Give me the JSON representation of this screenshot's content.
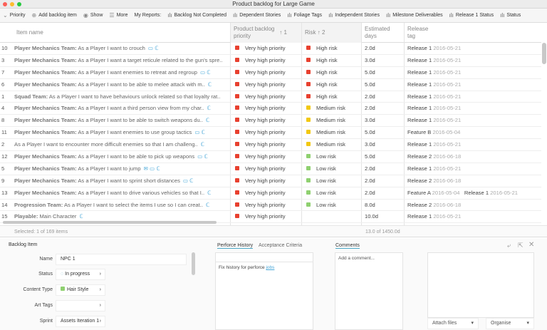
{
  "window": {
    "title": "Product backlog for Large Game"
  },
  "toolbar": {
    "items": [
      {
        "icon": "chevron-down-icon",
        "glyph": "⌄",
        "label": "Priority"
      },
      {
        "icon": "plus-circle-icon",
        "glyph": "⊕",
        "label": "Add backlog item"
      },
      {
        "icon": "eye-icon",
        "glyph": "◉",
        "label": "Show"
      },
      {
        "icon": "menu-icon",
        "glyph": "☰",
        "label": "More"
      },
      {
        "icon": "",
        "glyph": "",
        "label": "My Reports:"
      },
      {
        "icon": "bar-chart-icon",
        "glyph": "ılı",
        "label": "Backlog Not Completed"
      },
      {
        "icon": "bar-chart-icon",
        "glyph": "ılı",
        "label": "Dependent Stories"
      },
      {
        "icon": "bar-chart-icon",
        "glyph": "ılı",
        "label": "Foliage Tags"
      },
      {
        "icon": "bar-chart-icon",
        "glyph": "ılı",
        "label": "Independent Stories"
      },
      {
        "icon": "bar-chart-icon",
        "glyph": "ılı",
        "label": "Milestone Deliverables"
      },
      {
        "icon": "bar-chart-icon",
        "glyph": "ılı",
        "label": "Release 1 Status"
      },
      {
        "icon": "bar-chart-icon",
        "glyph": "ılı",
        "label": "Status"
      }
    ]
  },
  "table": {
    "headers": {
      "name": "Item name",
      "priority": "Product backlog priority",
      "priority_sort": "↑ 1",
      "risk": "Risk",
      "risk_sort": "↑ 2",
      "days": "Estimated days",
      "release": "Release tag"
    },
    "colors": {
      "Very high priority": "#e8402f",
      "High risk": "#e8402f",
      "Medium risk": "#f2c811",
      "Low risk": "#8fd070"
    },
    "rows": [
      {
        "id": "10",
        "team": "Player Mechanics Team:",
        "text": "As a Player I want to crouch",
        "icons": "▭ ℂ",
        "priority": "Very high priority",
        "risk": "High risk",
        "days": "2.0d",
        "tags": [
          [
            "Release 1",
            "2016-05-21"
          ]
        ]
      },
      {
        "id": "3",
        "team": "Player Mechanics Team:",
        "text": "As a Player I want a target reticule related to the gun's spre..",
        "icons": "",
        "priority": "Very high priority",
        "risk": "High risk",
        "days": "3.0d",
        "tags": [
          [
            "Release 1",
            "2016-05-21"
          ]
        ]
      },
      {
        "id": "7",
        "team": "Player Mechanics Team:",
        "text": "As a Player I want enemies to retreat and regroup",
        "icons": "▭ ℂ",
        "priority": "Very high priority",
        "risk": "High risk",
        "days": "5.0d",
        "tags": [
          [
            "Release 1",
            "2016-05-21"
          ]
        ]
      },
      {
        "id": "6",
        "team": "Player Mechanics Team:",
        "text": "As a Player I want to be able to melee attack with m..",
        "icons": "ℂ",
        "priority": "Very high priority",
        "risk": "High risk",
        "days": "5.0d",
        "tags": [
          [
            "Release 1",
            "2016-05-21"
          ]
        ]
      },
      {
        "id": "1",
        "team": "Squad Team:",
        "text": "As a Player I want to have behaviours unlock related so that loyalty rat..",
        "icons": "",
        "priority": "Very high priority",
        "risk": "High risk",
        "days": "2.0d",
        "tags": [
          [
            "Release 1",
            "2016-05-21"
          ]
        ]
      },
      {
        "id": "4",
        "team": "Player Mechanics Team:",
        "text": "As a Player I want a third person view from my char..",
        "icons": "ℂ",
        "priority": "Very high priority",
        "risk": "Medium risk",
        "days": "2.0d",
        "tags": [
          [
            "Release 1",
            "2016-05-21"
          ]
        ]
      },
      {
        "id": "8",
        "team": "Player Mechanics Team:",
        "text": "As a Player I want to be able to switch weapons du..",
        "icons": "ℂ",
        "priority": "Very high priority",
        "risk": "Medium risk",
        "days": "3.0d",
        "tags": [
          [
            "Release 1",
            "2016-05-21"
          ]
        ]
      },
      {
        "id": "11",
        "team": "Player Mechanics Team:",
        "text": "As a Player I want enemies to use group tactics",
        "icons": "▭ ℂ",
        "priority": "Very high priority",
        "risk": "Medium risk",
        "days": "5.0d",
        "tags": [
          [
            "Feature B",
            "2016-05-04"
          ]
        ]
      },
      {
        "id": "2",
        "team": "",
        "text": "As a Player I want to encounter more difficult enemies so that I am challeng..",
        "icons": "ℂ",
        "priority": "Very high priority",
        "risk": "Medium risk",
        "days": "3.0d",
        "tags": [
          [
            "Release 1",
            "2016-05-21"
          ]
        ]
      },
      {
        "id": "12",
        "team": "Player Mechanics Team:",
        "text": "As a Player I want to be able to pick up weapons",
        "icons": "▭ ℂ",
        "priority": "Very high priority",
        "risk": "Low risk",
        "days": "5.0d",
        "tags": [
          [
            "Release 2",
            "2016-06-18"
          ]
        ]
      },
      {
        "id": "5",
        "team": "Player Mechanics Team:",
        "text": "As a Player I want to jump",
        "icons": "✉ ▭ ℂ",
        "priority": "Very high priority",
        "risk": "Low risk",
        "days": "2.0d",
        "tags": [
          [
            "Release 1",
            "2016-05-21"
          ]
        ]
      },
      {
        "id": "9",
        "team": "Player Mechanics Team:",
        "text": "As a Player I want to sprint short distances",
        "icons": "▭ ℂ",
        "priority": "Very high priority",
        "risk": "Low risk",
        "days": "2.0d",
        "tags": [
          [
            "Release 2",
            "2016-06-18"
          ]
        ]
      },
      {
        "id": "13",
        "team": "Player Mechanics Team:",
        "text": "As a Player I want to drive various vehicles so that I..",
        "icons": "ℂ",
        "priority": "Very high priority",
        "risk": "Low risk",
        "days": "2.0d",
        "tags": [
          [
            "Feature A",
            "2016-05-04"
          ],
          [
            "Release 1",
            "2016-05-21"
          ]
        ]
      },
      {
        "id": "14",
        "team": "Progression Team:",
        "text": "As a Player I want to select the items I use so I can creat..",
        "icons": "ℂ",
        "priority": "Very high priority",
        "risk": "Low risk",
        "days": "8.0d",
        "tags": [
          [
            "Release 2",
            "2016-06-18"
          ]
        ]
      },
      {
        "id": "15",
        "team": "Playable:",
        "text": "Main Character",
        "icons": "ℂ",
        "priority": "Very high priority",
        "risk": "",
        "days": "10.0d",
        "tags": [
          [
            "Release 1",
            "2016-05-21"
          ]
        ]
      }
    ]
  },
  "status": {
    "selected": "Selected: 1 of 169 items",
    "total": "13.0 of 1450.0d"
  },
  "detail": {
    "title": "Backlog Item",
    "name_label": "Name",
    "name_value": "NPC 1",
    "status_label": "Status",
    "status_value": "In progress",
    "content_label": "Content Type",
    "content_value": "Hair Style",
    "art_label": "Art Tags",
    "art_value": "",
    "sprint_label": "Sprint",
    "sprint_value": "Assets Iteration 1"
  },
  "history": {
    "tab1": "Perforce History",
    "tab2": "Acceptance Criteria",
    "text": "Fix history for perforce",
    "link": "jobs"
  },
  "comments": {
    "tab": "Comments",
    "placeholder": "Add a comment..."
  },
  "attach": {
    "attach_label": "Attach files",
    "organise_label": "Organise"
  }
}
